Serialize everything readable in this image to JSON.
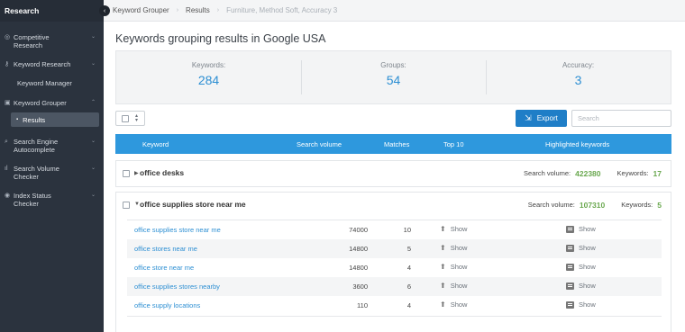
{
  "sidebar": {
    "title": "Research",
    "items": [
      {
        "icon": "target-icon",
        "label_line1": "Competitive",
        "label_line2": "Research",
        "expanded": false
      },
      {
        "icon": "key-icon",
        "label_line1": "Keyword Research",
        "label_line2": "",
        "expanded": false
      },
      {
        "icon": "",
        "label_line1": "Keyword Manager",
        "label_line2": "",
        "expanded": false
      },
      {
        "icon": "grouper-icon",
        "label_line1": "Keyword Grouper",
        "label_line2": "",
        "expanded": true
      },
      {
        "icon": "search-icon",
        "label_line1": "Search Engine",
        "label_line2": "Autocomplete",
        "expanded": false
      },
      {
        "icon": "chart-icon",
        "label_line1": "Search Volume",
        "label_line2": "Checker",
        "expanded": false
      },
      {
        "icon": "index-icon",
        "label_line1": "Index Status",
        "label_line2": "Checker",
        "expanded": false
      }
    ],
    "sub_item": "Results"
  },
  "breadcrumb": {
    "items": [
      "Keyword Grouper",
      "Results",
      "Furniture, Method Soft, Accuracy 3"
    ]
  },
  "page_title": "Keywords grouping results in Google USA",
  "stats": [
    {
      "label": "Keywords:",
      "value": "284"
    },
    {
      "label": "Groups:",
      "value": "54"
    },
    {
      "label": "Accuracy:",
      "value": "3"
    }
  ],
  "toolbar": {
    "export_label": "Export",
    "search_placeholder": "Search"
  },
  "table": {
    "headers": {
      "keyword": "Keyword",
      "search_volume": "Search volume",
      "matches": "Matches",
      "top10": "Top 10",
      "highlighted": "Highlighted keywords"
    },
    "groups": [
      {
        "name": "office desks",
        "volume_label": "Search volume:",
        "volume": "422380",
        "keywords_label": "Keywords:",
        "keywords": "17",
        "expanded": false
      },
      {
        "name": "office supplies store near me",
        "volume_label": "Search volume:",
        "volume": "107310",
        "keywords_label": "Keywords:",
        "keywords": "5",
        "expanded": true
      }
    ],
    "rows": [
      {
        "keyword": "office supplies store near me",
        "volume": "74000",
        "matches": "10",
        "top10": "Show",
        "highlighted": "Show"
      },
      {
        "keyword": "office stores near me",
        "volume": "14800",
        "matches": "5",
        "top10": "Show",
        "highlighted": "Show"
      },
      {
        "keyword": "office store near me",
        "volume": "14800",
        "matches": "4",
        "top10": "Show",
        "highlighted": "Show"
      },
      {
        "keyword": "office supplies stores nearby",
        "volume": "3600",
        "matches": "6",
        "top10": "Show",
        "highlighted": "Show"
      },
      {
        "keyword": "office supply locations",
        "volume": "110",
        "matches": "4",
        "top10": "Show",
        "highlighted": "Show"
      }
    ]
  },
  "colors": {
    "sidebar_bg": "#2b333e",
    "accent": "#2e98dd",
    "value_blue": "#2d8fd3",
    "count_green": "#6aa84f",
    "export_bg": "#1f7ec7"
  }
}
